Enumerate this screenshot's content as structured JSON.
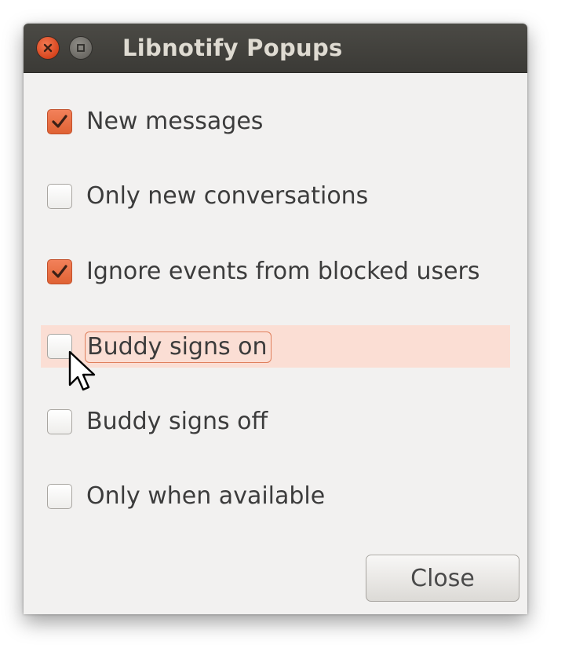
{
  "window": {
    "title": "Libnotify Popups"
  },
  "options": [
    {
      "label": "New messages",
      "checked": true
    },
    {
      "label": "Only new conversations",
      "checked": false
    },
    {
      "label": "Ignore events from blocked users",
      "checked": true
    },
    {
      "label": "Buddy signs on",
      "checked": false,
      "hovered": true
    },
    {
      "label": "Buddy signs off",
      "checked": false
    },
    {
      "label": "Only when available",
      "checked": false
    }
  ],
  "buttons": {
    "close_label": "Close"
  },
  "icons": {
    "window_close": "close-icon",
    "window_maximize": "maximize-icon",
    "checkmark": "checkmark-icon",
    "cursor": "mouse-pointer-icon"
  },
  "colors": {
    "accent": "#e8683d",
    "titlebar": "#3c3b37",
    "window_bg": "#f2f1f0",
    "hover_row": "#fbded4"
  }
}
